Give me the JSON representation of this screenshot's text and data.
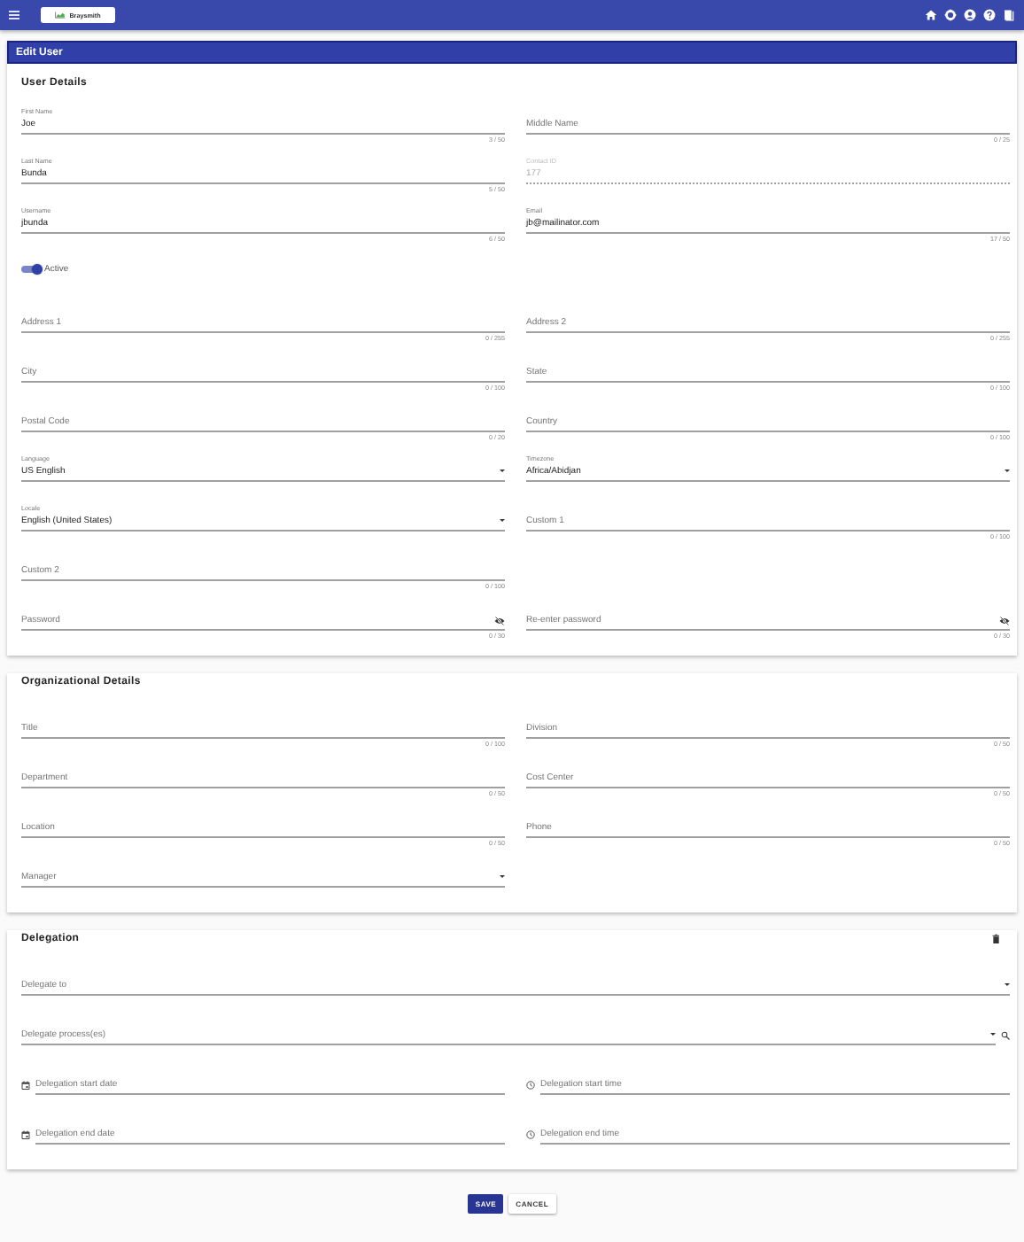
{
  "app_bar": {
    "logo_text": "Braysmith"
  },
  "page_title": "Edit User",
  "sections": [
    {
      "title": "User Details",
      "rows": [
        [
          {
            "kind": "text",
            "label": "First Name",
            "value": "Joe",
            "counter": "3 / 50",
            "disabled": false
          },
          {
            "kind": "text",
            "label": "Middle Name",
            "counter": "0 / 25",
            "disabled": false
          }
        ],
        [
          {
            "kind": "text",
            "label": "Last Name",
            "value": "Bunda",
            "counter": "5 / 50",
            "disabled": false
          },
          {
            "kind": "text",
            "label": "Contact ID",
            "value": "177",
            "disabled": true
          }
        ],
        [
          {
            "kind": "text",
            "label": "Username",
            "value": "jbunda",
            "counter": "6 / 50",
            "disabled": false
          },
          {
            "kind": "text",
            "label": "Email",
            "value": "jb@mailinator.com",
            "counter": "17 / 50",
            "disabled": false
          }
        ],
        [
          {
            "kind": "toggle",
            "label": "Active",
            "on": true
          }
        ],
        [
          {
            "kind": "text",
            "label": "Address 1",
            "counter": "0 / 255",
            "disabled": false
          },
          {
            "kind": "text",
            "label": "Address 2",
            "counter": "0 / 255",
            "disabled": false
          }
        ],
        [
          {
            "kind": "text",
            "label": "City",
            "counter": "0 / 100",
            "disabled": false
          },
          {
            "kind": "text",
            "label": "State",
            "counter": "0 / 100",
            "disabled": false
          }
        ],
        [
          {
            "kind": "text",
            "label": "Postal Code",
            "counter": "0 / 20",
            "disabled": false
          },
          {
            "kind": "text",
            "label": "Country",
            "counter": "0 / 100",
            "disabled": false
          }
        ],
        [
          {
            "kind": "select",
            "label": "Language",
            "value": "US English",
            "disabled": false
          },
          {
            "kind": "select",
            "label": "Timezone",
            "value": "Africa/Abidjan",
            "disabled": false
          }
        ],
        [
          {
            "kind": "select",
            "label": "Locale",
            "value": "English (United States)",
            "disabled": false
          },
          {
            "kind": "text",
            "label": "Custom 1",
            "counter": "0 / 100",
            "disabled": false
          }
        ],
        [
          {
            "kind": "text",
            "label": "Custom 2",
            "counter": "0 / 100",
            "disabled": false
          }
        ],
        [
          {
            "kind": "password",
            "label": "Password",
            "counter": "0 / 30",
            "disabled": false
          },
          {
            "kind": "password",
            "label": "Re-enter password",
            "counter": "0 / 30",
            "disabled": false
          }
        ]
      ]
    },
    {
      "title": "Organizational Details",
      "rows": [
        [
          {
            "kind": "text",
            "label": "Title",
            "counter": "0 / 100",
            "disabled": false
          },
          {
            "kind": "text",
            "label": "Division",
            "counter": "0 / 50",
            "disabled": false
          }
        ],
        [
          {
            "kind": "text",
            "label": "Department",
            "counter": "0 / 50",
            "disabled": false
          },
          {
            "kind": "text",
            "label": "Cost Center",
            "counter": "0 / 50",
            "disabled": false
          }
        ],
        [
          {
            "kind": "text",
            "label": "Location",
            "counter": "0 / 50",
            "disabled": false
          },
          {
            "kind": "text",
            "label": "Phone",
            "counter": "0 / 50",
            "disabled": false
          }
        ],
        [
          {
            "kind": "select",
            "label": "Manager",
            "disabled": false
          }
        ]
      ]
    },
    {
      "title": "Delegation",
      "deletable": true,
      "rows": [
        [
          {
            "kind": "select",
            "label": "Delegate to",
            "wide": true,
            "disabled": false
          }
        ],
        [
          {
            "kind": "lookup",
            "label": "Delegate process(es)",
            "wide": true,
            "disabled": false
          }
        ],
        [
          {
            "kind": "date",
            "label": "Delegation start date",
            "disabled": false
          },
          {
            "kind": "time",
            "label": "Delegation start time",
            "disabled": false
          }
        ],
        [
          {
            "kind": "date",
            "label": "Delegation end date",
            "disabled": false
          },
          {
            "kind": "time",
            "label": "Delegation end time",
            "disabled": false
          }
        ]
      ]
    }
  ],
  "buttons": [
    {
      "label": "SAVE",
      "kind": "primary"
    },
    {
      "label": "CANCEL",
      "kind": "secondary"
    }
  ]
}
